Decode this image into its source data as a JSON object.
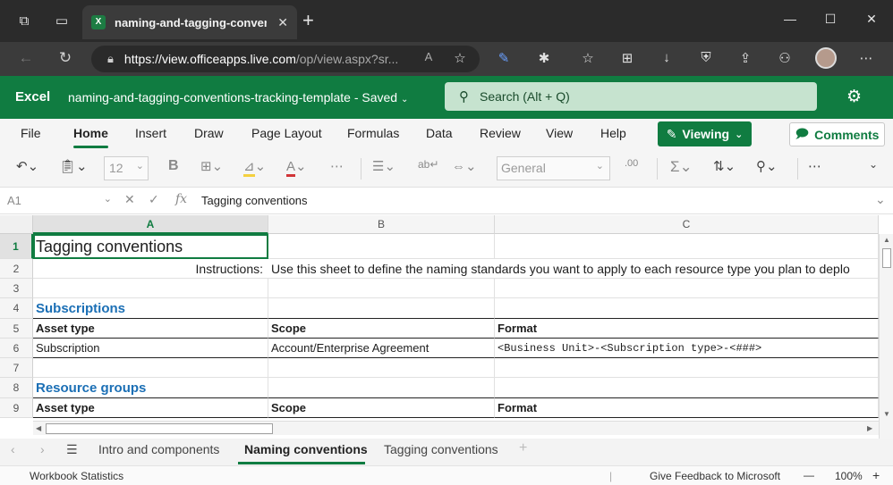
{
  "browser": {
    "tab_title": "naming-and-tagging-conventio",
    "tab_icon": "X",
    "url_host": "https://view.officeapps.live.com",
    "url_rest": "/op/view.aspx?sr..."
  },
  "excel": {
    "app_name": "Excel",
    "doc_title": "naming-and-tagging-conventions-tracking-template  -  Saved",
    "search_placeholder": "Search (Alt + Q)",
    "accent": "#107c41"
  },
  "ribbon": {
    "menus": [
      "File",
      "Home",
      "Insert",
      "Draw",
      "Page Layout",
      "Formulas",
      "Data",
      "Review",
      "View",
      "Help"
    ],
    "active_menu": "Home",
    "viewing_label": "Viewing",
    "comments_label": "Comments",
    "font_size": "12",
    "number_format": "General"
  },
  "formula_bar": {
    "name_box": "A1",
    "fx": "fx",
    "value": "Tagging conventions"
  },
  "grid": {
    "columns": [
      "A",
      "B",
      "C"
    ],
    "rows": [
      "1",
      "2",
      "3",
      "4",
      "5",
      "6",
      "7",
      "8",
      "9"
    ],
    "cells": {
      "A1": "Tagging conventions",
      "A2": "Instructions:",
      "B2": "Use this sheet to define the naming standards you want to apply to each resource type you plan to deplo",
      "A4": "Subscriptions",
      "A5": "Asset type",
      "B5": "Scope",
      "C5": "Format",
      "A6": "Subscription",
      "B6": "Account/Enterprise Agreement",
      "C6": "<Business Unit>-<Subscription type>-<###>",
      "A8": "Resource groups",
      "A9": "Asset type",
      "B9": "Scope",
      "C9": "Format"
    }
  },
  "sheets": {
    "tabs": [
      "Intro and components",
      "Naming conventions",
      "Tagging conventions"
    ],
    "active": "Naming conventions"
  },
  "status": {
    "left": "Workbook Statistics",
    "feedback": "Give Feedback to Microsoft",
    "zoom": "100%"
  }
}
